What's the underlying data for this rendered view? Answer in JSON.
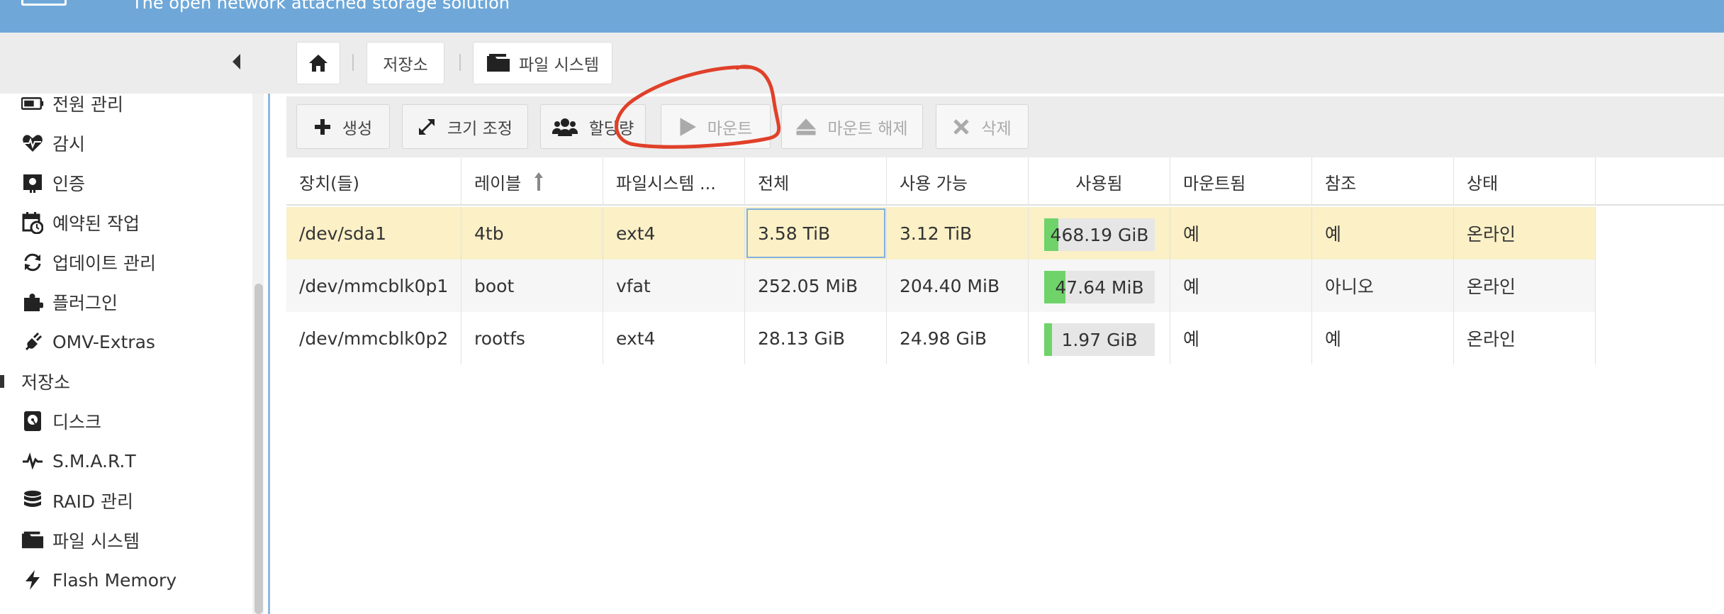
{
  "header": {
    "tagline": "The open network attached storage solution"
  },
  "breadcrumb": {
    "home_icon": "home-icon",
    "storage": "저장소",
    "filesystem": "파일 시스템"
  },
  "sidebar": {
    "items": [
      {
        "label": "전원 관리",
        "icon": "battery-icon"
      },
      {
        "label": "감시",
        "icon": "heartbeat-icon"
      },
      {
        "label": "인증",
        "icon": "certificate-icon"
      },
      {
        "label": "예약된 작업",
        "icon": "calendar-clock-icon"
      },
      {
        "label": "업데이트 관리",
        "icon": "sync-icon"
      },
      {
        "label": "플러그인",
        "icon": "puzzle-icon"
      },
      {
        "label": "OMV-Extras",
        "icon": "plug-icon"
      }
    ],
    "group": "저장소",
    "storage_items": [
      {
        "label": "디스크",
        "icon": "disk-icon"
      },
      {
        "label": "S.M.A.R.T",
        "icon": "pulse-icon"
      },
      {
        "label": "RAID 관리",
        "icon": "database-icon"
      },
      {
        "label": "파일 시스템",
        "icon": "folder-icon"
      },
      {
        "label": "Flash Memory",
        "icon": "bolt-icon"
      }
    ]
  },
  "toolbar": {
    "create": "생성",
    "resize": "크기 조정",
    "quota": "할당량",
    "mount": "마운트",
    "unmount": "마운트 해제",
    "delete": "삭제"
  },
  "table": {
    "columns": [
      "장치(들)",
      "레이블",
      "파일시스템 ...",
      "전체",
      "사용 가능",
      "사용됨",
      "마운트됨",
      "참조",
      "상태"
    ],
    "sort_column": "레이블",
    "rows": [
      {
        "device": "/dev/sda1",
        "label": "4tb",
        "fs": "ext4",
        "total": "3.58 TiB",
        "available": "3.12 TiB",
        "used": "468.19 GiB",
        "used_fraction": 0.13,
        "mounted": "예",
        "referenced": "예",
        "status": "온라인",
        "selected": true
      },
      {
        "device": "/dev/mmcblk0p1",
        "label": "boot",
        "fs": "vfat",
        "total": "252.05 MiB",
        "available": "204.40 MiB",
        "used": "47.64 MiB",
        "used_fraction": 0.19,
        "mounted": "예",
        "referenced": "아니오",
        "status": "온라인",
        "selected": false
      },
      {
        "device": "/dev/mmcblk0p2",
        "label": "rootfs",
        "fs": "ext4",
        "total": "28.13 GiB",
        "available": "24.98 GiB",
        "used": "1.97 GiB",
        "used_fraction": 0.07,
        "mounted": "예",
        "referenced": "예",
        "status": "온라인",
        "selected": false
      }
    ]
  },
  "colors": {
    "header": "#6fa8d8",
    "selected_row": "#fbf0c6",
    "alt_row": "#f6f6f6",
    "usage_bar": "#6fd36a",
    "annotation": "#e0402a"
  }
}
